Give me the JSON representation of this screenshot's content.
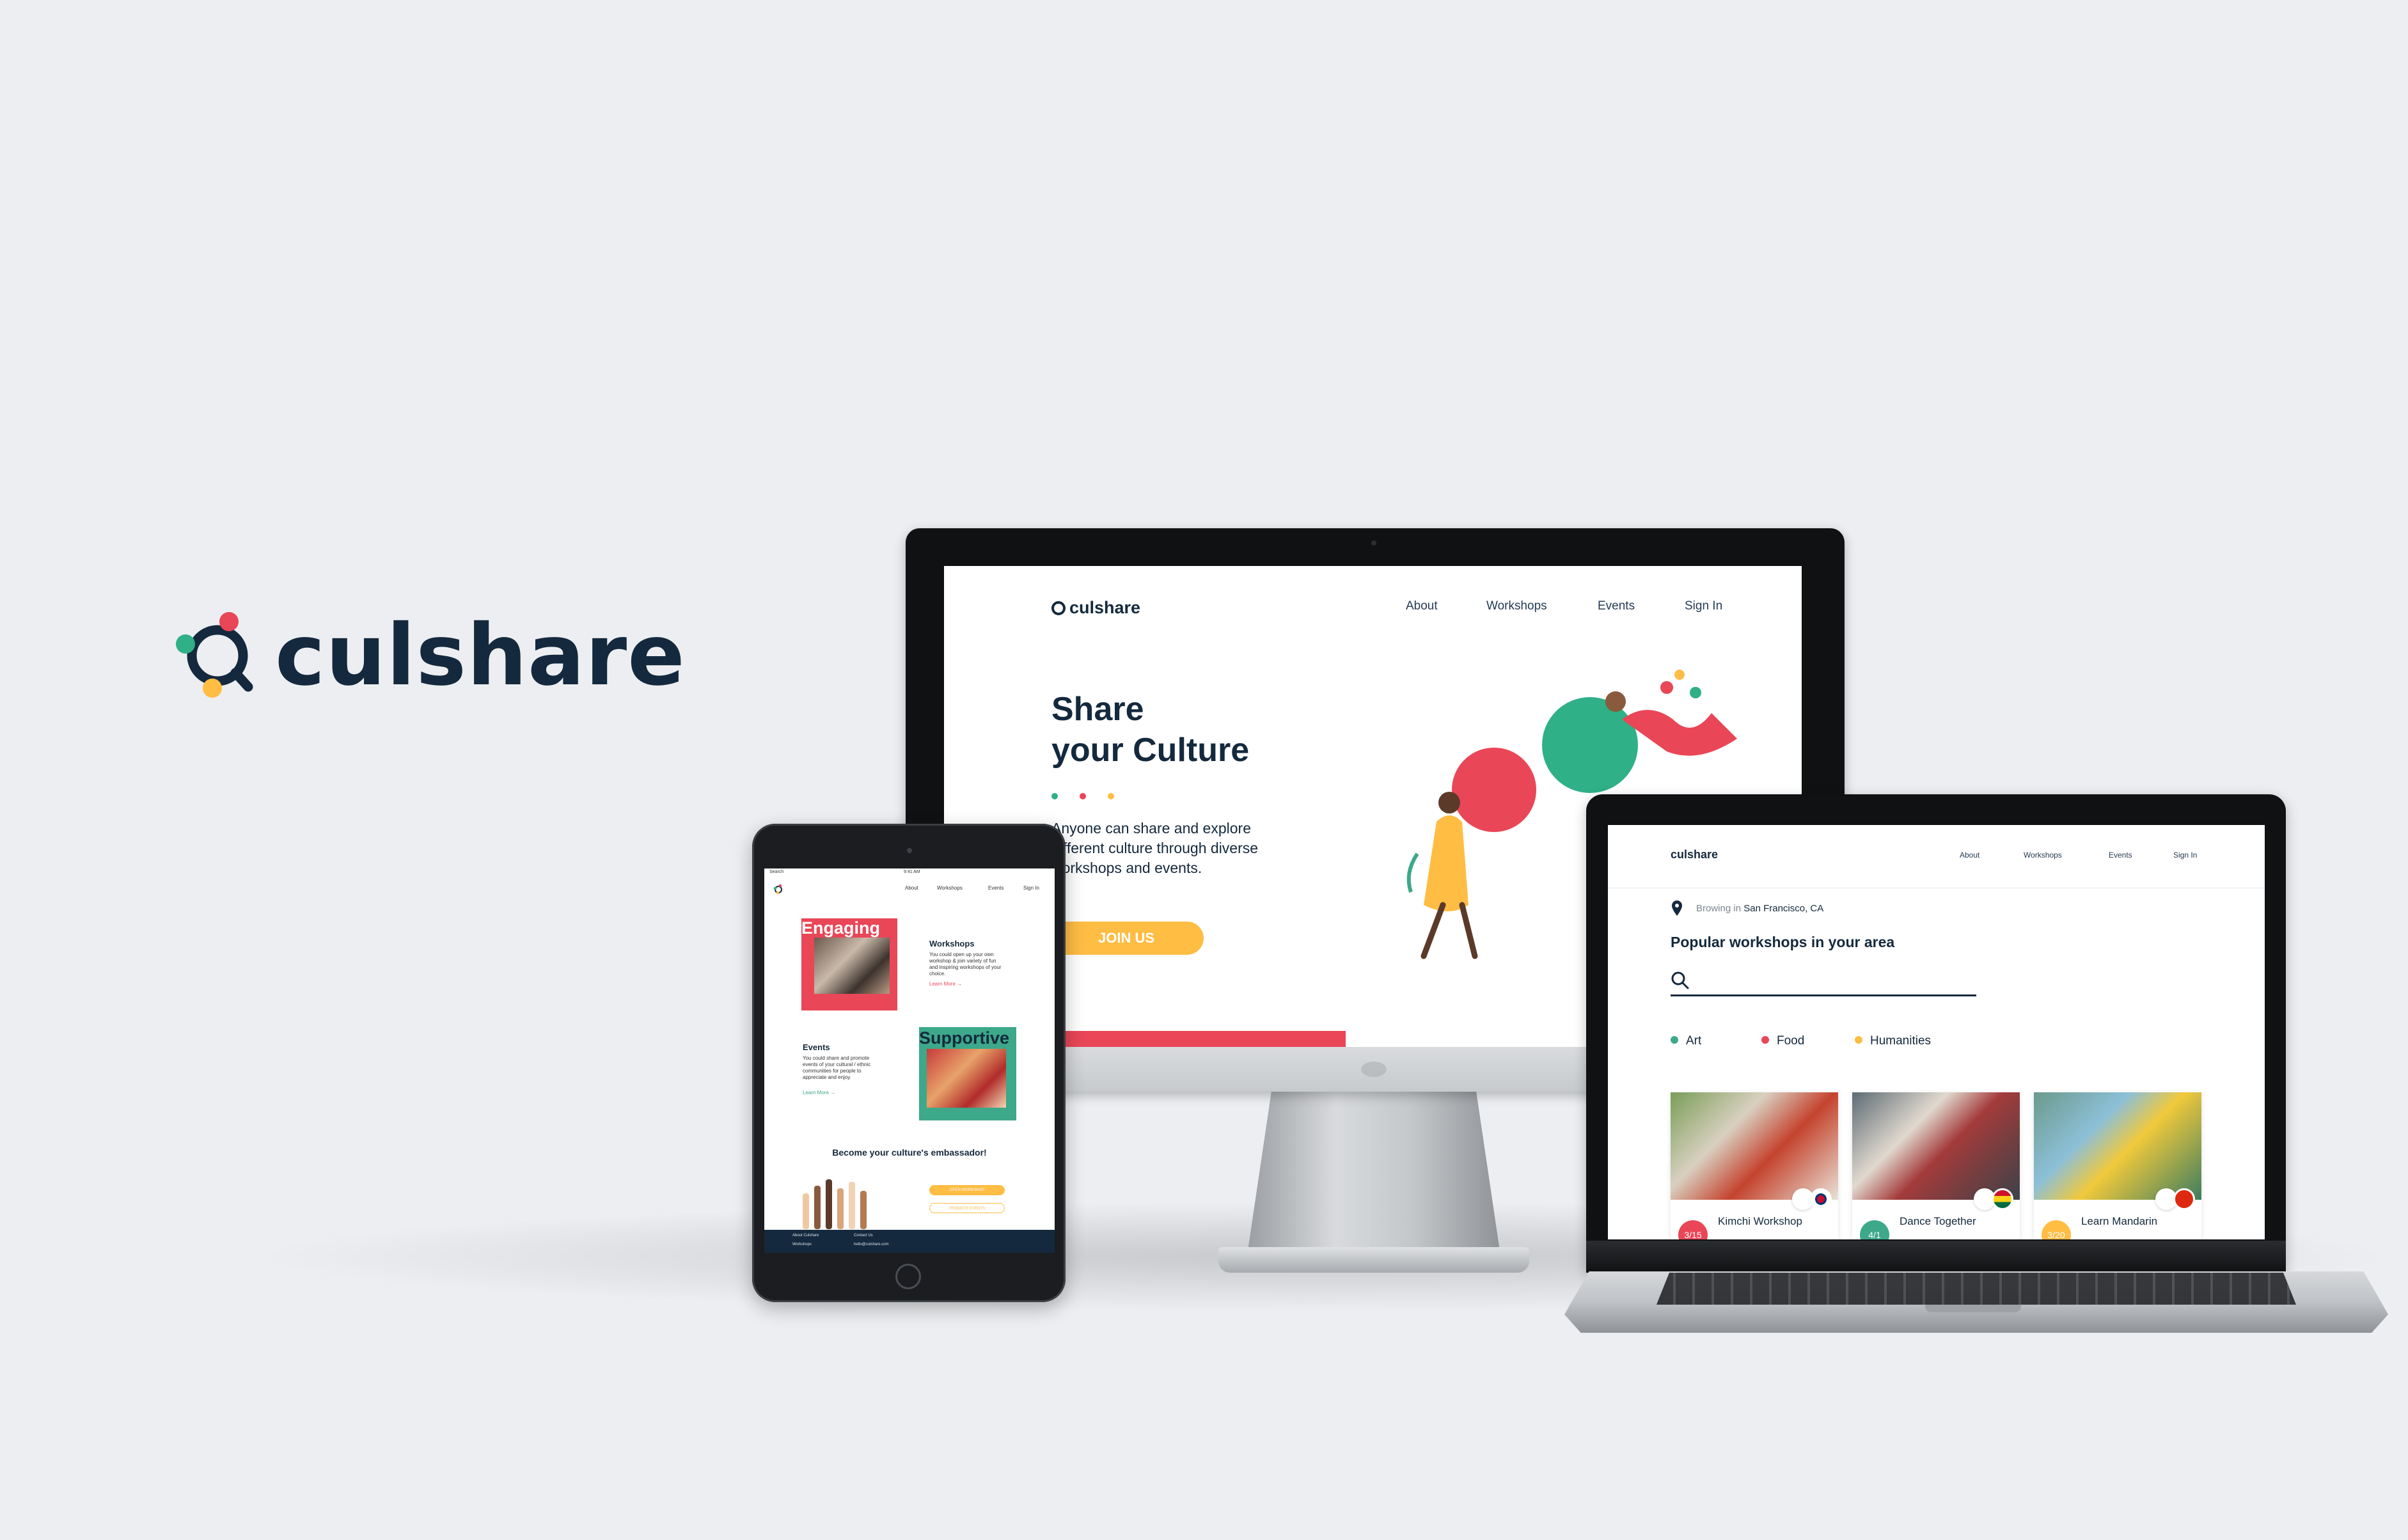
{
  "brand": {
    "name": "culshare"
  },
  "colors": {
    "navy": "#14293d",
    "green": "#2fb086",
    "red": "#e94657",
    "yellow": "#ffbd44",
    "teal": "#3da88a"
  },
  "desktop": {
    "logo": "culshare",
    "nav": [
      "About",
      "Workshops",
      "Events",
      "Sign In"
    ],
    "hero_title_line1": "Share",
    "hero_title_line2": "your Culture",
    "description": "Anyone can share and explore different culture through diverse workshops and events.",
    "cta": "JOIN US"
  },
  "tablet": {
    "status_left": "Search",
    "status_center": "9:41 AM",
    "nav": [
      "About",
      "Workshops",
      "Events",
      "Sign In"
    ],
    "card1_title": "Engaging",
    "workshops_heading": "Workshops",
    "workshops_text": "You could open up your own workshop & join variety of fun and inspiring workshops of your choice.",
    "learn_more": "Learn More",
    "events_heading": "Events",
    "events_text": "You could share and promote events of your cultural / ethnic communities for people to appreciate and enjoy.",
    "card2_title": "Supportive",
    "embassador": "Become your culture's embassador!",
    "btn_workshop": "OPEN WORKSHOP",
    "btn_events": "PROMOTE EVENTS",
    "footer_about": "About Culshare",
    "footer_contact": "Contact Us",
    "footer_workshops": "Workshops",
    "footer_email": "hello@culshare.com"
  },
  "laptop": {
    "logo": "culshare",
    "nav": [
      "About",
      "Workshops",
      "Events",
      "Sign In"
    ],
    "browsing_prefix": "Browing in",
    "browsing_location": "San Francisco, CA",
    "section_title": "Popular workshops in your area",
    "search_placeholder": "",
    "categories": [
      {
        "label": "Art",
        "color": "#3da88a"
      },
      {
        "label": "Food",
        "color": "#e94657"
      },
      {
        "label": "Humanities",
        "color": "#ffbd44"
      }
    ],
    "cards": [
      {
        "title": "Kimchi Workshop",
        "date": "3/15",
        "date_color": "#e94657",
        "flag": "korea-flag-icon"
      },
      {
        "title": "Dance Together",
        "date": "4/1",
        "date_color": "#3da88a",
        "flag": "ghana-flag-icon"
      },
      {
        "title": "Learn Mandarin",
        "date": "3/20",
        "date_color": "#ffbd44",
        "flag": "china-flag-icon"
      }
    ]
  }
}
